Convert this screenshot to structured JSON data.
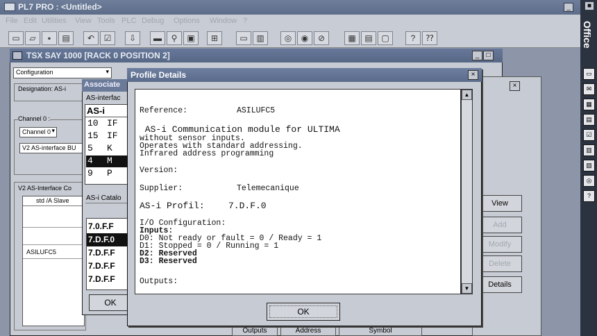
{
  "app": {
    "title": "PL7 PRO : <Untitled>",
    "menu": [
      "File",
      "Edit",
      "Utilities",
      "View",
      "Tools",
      "PLC",
      "Debug",
      "Options",
      "Window",
      "?"
    ]
  },
  "office_bar": {
    "label": "Office"
  },
  "config_window": {
    "title": "TSX SAY 1000 [RACK 0    POSITION 2]",
    "view_select": "Configuration",
    "designation_label": "Designation: AS-i",
    "channel_group_label": "Channel 0 :",
    "channel_select": "Channel 0",
    "function_field": "V2 AS-interface BU",
    "v2_group_label": "V2 AS-Interface Co",
    "slave_column_header": "std /A Slave",
    "slave_entry": "ASILUFC5",
    "buttons": {
      "view": "View",
      "add": "Add",
      "modify": "Modify",
      "delete": "Delete",
      "details": "Details"
    },
    "bottom_tabs": [
      "Outputs",
      "Address",
      "Symbol"
    ]
  },
  "associate_dialog": {
    "title": "Associate",
    "subtitle": "AS-interfac",
    "list_header": "AS-i",
    "slaves": [
      {
        "addr": "10",
        "code": "IF",
        "selected": false
      },
      {
        "addr": "15",
        "code": "IF",
        "selected": false
      },
      {
        "addr": "5",
        "code": "K",
        "selected": false
      },
      {
        "addr": "4",
        "code": "M",
        "selected": true
      },
      {
        "addr": "9",
        "code": "P",
        "selected": false
      }
    ],
    "catalog_label": "AS-i Catalo",
    "profiles": [
      {
        "label": "7.0.F.F",
        "selected": false
      },
      {
        "label": "7.D.F.0",
        "selected": true
      },
      {
        "label": "7.D.F.F",
        "selected": false
      },
      {
        "label": "7.D.F.F",
        "selected": false
      },
      {
        "label": "7.D.F.F",
        "selected": false
      }
    ],
    "ok_label": "OK"
  },
  "profile_details": {
    "title": "Profile Details",
    "reference_label": "Reference:",
    "reference_value": "ASILUFC5",
    "description_title": " AS-i Communication module for ULTIMA",
    "description_lines": [
      "without sensor inputs.",
      "Operates with standard addressing.",
      "Infrared address programming"
    ],
    "version_label": "Version:",
    "supplier_label": "Supplier:",
    "supplier_value": "Telemecanique",
    "profile_label": "AS-i Profil:",
    "profile_value": "7.D.F.0",
    "io_config_label": "I/O Configuration:",
    "inputs_label": "Inputs:",
    "inputs": [
      "D0: Not ready or fault = 0 / Ready = 1",
      "D1: Stopped = 0 / Running = 1",
      "D2: Reserved",
      "D3: Reserved"
    ],
    "outputs_label": "Outputs:",
    "ok_label": "OK"
  }
}
